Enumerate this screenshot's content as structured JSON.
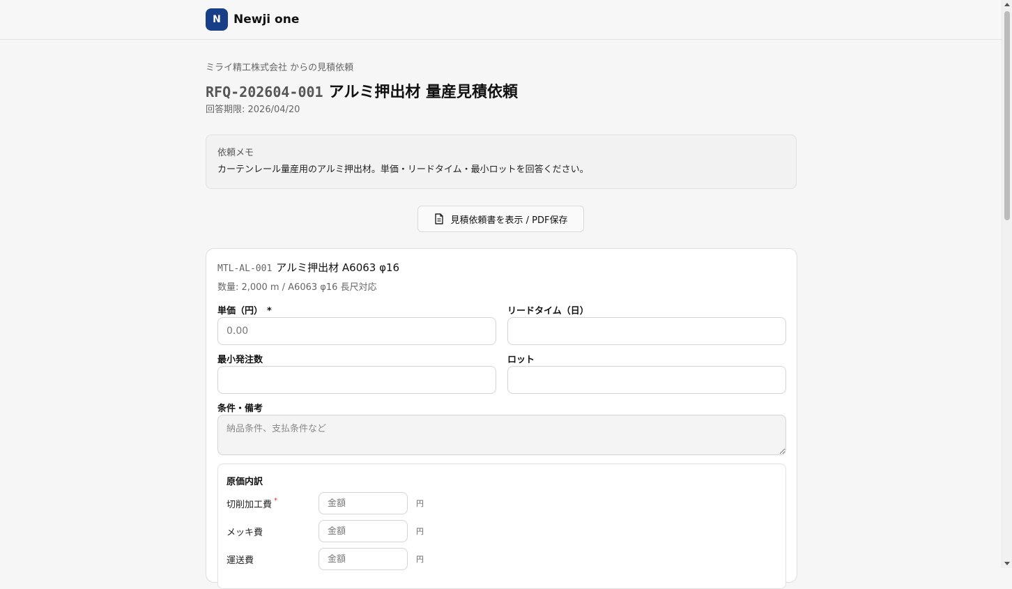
{
  "header": {
    "logo_letter": "N",
    "app_name": "Newji one"
  },
  "rfq": {
    "from_line": "ミライ精工株式会社 からの見積依頼",
    "code": "RFQ-202604-001",
    "title": "アルミ押出材 量産見積依頼",
    "deadline": "回答期限: 2026/04/20"
  },
  "memo": {
    "label": "依頼メモ",
    "text": "カーテンレール量産用のアルミ押出材。単価・リードタイム・最小ロットを回答ください。"
  },
  "pdf_button": {
    "label": "見積依頼書を表示 / PDF保存",
    "icon": "document-icon"
  },
  "item": {
    "code": "MTL-AL-001",
    "name": "アルミ押出材 A6063 φ16",
    "sub": "数量: 2,000 m / A6063 φ16 長尺対応",
    "fields": {
      "unit_price_label": "単価（円）",
      "required_mark": "*",
      "unit_price_placeholder": "0.00",
      "lead_time_label": "リードタイム（日）",
      "lead_time_value": "",
      "min_order_label": "最小発注数",
      "min_order_value": "",
      "lot_label": "ロット",
      "lot_value": "",
      "notes_label": "条件・備考",
      "notes_placeholder": "納品条件、支払条件など"
    },
    "cost_breakdown": {
      "title": "原価内訳",
      "required_dot": "*",
      "rows": [
        {
          "label": "切削加工費",
          "placeholder": "金額",
          "unit": "円",
          "required": true
        },
        {
          "label": "メッキ費",
          "placeholder": "金額",
          "unit": "円",
          "required": false
        },
        {
          "label": "運送費",
          "placeholder": "金額",
          "unit": "円",
          "required": false
        }
      ]
    }
  }
}
